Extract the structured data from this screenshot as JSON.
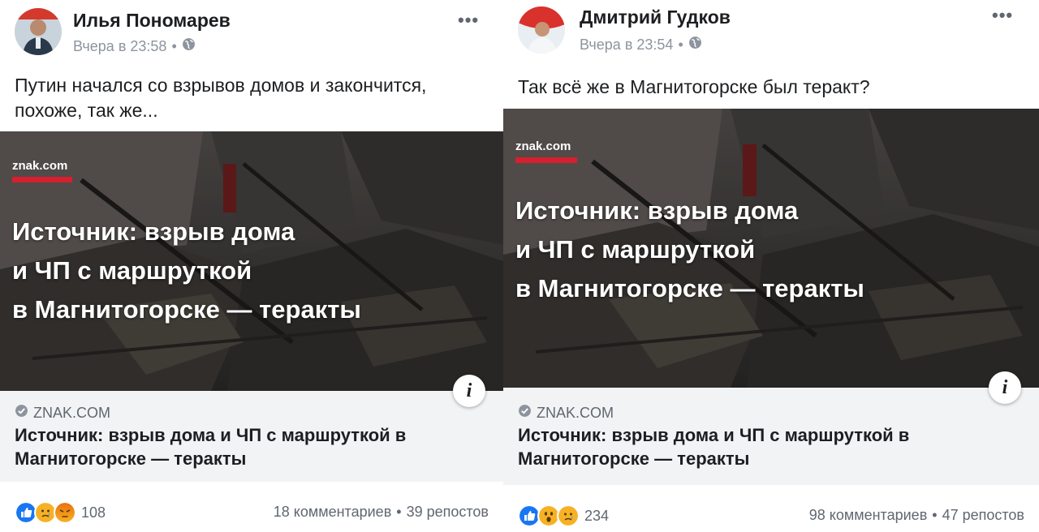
{
  "posts": [
    {
      "author": "Илья Пономарев",
      "time": "Вчера в 23:58",
      "separator": "•",
      "text_line1": "Путин начался со взрывов домов и закончится,",
      "text_line2": "похоже, так же...",
      "link": {
        "brand": "znak.com",
        "image_headline_line1": "Источник: взрыв дома",
        "image_headline_line2": "и ЧП с маршруткой",
        "image_headline_line3": "в Магнитогорске — теракты",
        "info_glyph": "i",
        "domain": "ZNAK.COM",
        "title_line1": "Источник: взрыв дома и ЧП с маршруткой в",
        "title_line2": "Магнитогорске — теракты"
      },
      "reactions": [
        "like",
        "sad",
        "angry"
      ],
      "reaction_count": "108",
      "comments": "18 комментариев",
      "shares": "39 репостов",
      "dot": "•"
    },
    {
      "author": "Дмитрий Гудков",
      "time": "Вчера в 23:54",
      "separator": "•",
      "text_line1": "Так всё же в Магнитогорске был теракт?",
      "link": {
        "brand": "znak.com",
        "image_headline_line1": "Источник: взрыв дома",
        "image_headline_line2": "и ЧП с маршруткой",
        "image_headline_line3": "в Магнитогорске — теракты",
        "info_glyph": "i",
        "domain": "ZNAK.COM",
        "title_line1": "Источник: взрыв дома и ЧП с маршруткой в",
        "title_line2": "Магнитогорске — теракты"
      },
      "reactions": [
        "like",
        "wow",
        "sad"
      ],
      "reaction_count": "234",
      "comments": "98 комментариев",
      "shares": "47 репостов",
      "dot": "•"
    }
  ],
  "more_glyph": "•••",
  "colors": {
    "like": "#1877f2",
    "reaction_yellow": "#f7b125",
    "angry": "#e9710f",
    "brand_bar": "#d71f2e",
    "caption_bg": "#f2f3f5"
  }
}
